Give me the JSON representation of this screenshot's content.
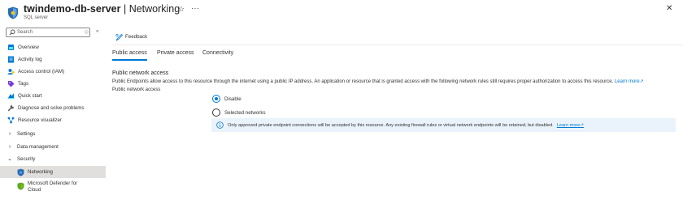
{
  "header": {
    "resource_name": "twindemo-db-server",
    "separator": "|",
    "blade_name": "Networking",
    "subtitle": "SQL server",
    "favorite_icon": "star-icon",
    "more_icon": "ellipsis-icon",
    "close_icon": "close-icon",
    "star_glyph": "☆",
    "more_glyph": "···",
    "close_glyph": "✕"
  },
  "sidebar": {
    "search_placeholder": "Search",
    "collapse_glyph": "«",
    "sort_glyph": "◇",
    "items": [
      {
        "label": "Overview",
        "icon": "sql-server-icon"
      },
      {
        "label": "Activity log",
        "icon": "activity-log-icon"
      },
      {
        "label": "Access control (IAM)",
        "icon": "iam-icon"
      },
      {
        "label": "Tags",
        "icon": "tag-icon"
      },
      {
        "label": "Quick start",
        "icon": "quick-start-icon"
      },
      {
        "label": "Diagnose and solve problems",
        "icon": "wrench-icon"
      },
      {
        "label": "Resource visualizer",
        "icon": "visualizer-icon"
      },
      {
        "label": "Settings",
        "expander": "›"
      },
      {
        "label": "Data management",
        "expander": "›"
      },
      {
        "label": "Security",
        "expander": "⌄"
      },
      {
        "label": "Networking",
        "icon": "networking-shield-icon",
        "selected": true
      },
      {
        "label": "Microsoft Defender for Cloud",
        "icon": "defender-icon"
      }
    ]
  },
  "toolbar": {
    "feedback_label": "Feedback"
  },
  "tabs": [
    {
      "label": "Public access",
      "active": true
    },
    {
      "label": "Private access"
    },
    {
      "label": "Connectivity"
    }
  ],
  "content": {
    "section_title": "Public network access",
    "description": "Public Endpoints allow access to this resource through the internet using a public IP address. An application or resource that is granted access with the following network rules still requires proper authorization to access this resource.",
    "description_link": "Learn more",
    "field_label": "Public network access",
    "options": [
      {
        "label": "Disable",
        "checked": true
      },
      {
        "label": "Selected networks",
        "checked": false
      }
    ],
    "info_text": "Only approved private endpoint connections will be accepted by this resource. Any existing firewall rules or virtual network endpoints will be retained, but disabled.",
    "info_link": "Learn more"
  },
  "colors": {
    "accent": "#0078d4",
    "selected_bg": "#e1dfdd",
    "info_bg": "#eaf3fb"
  }
}
